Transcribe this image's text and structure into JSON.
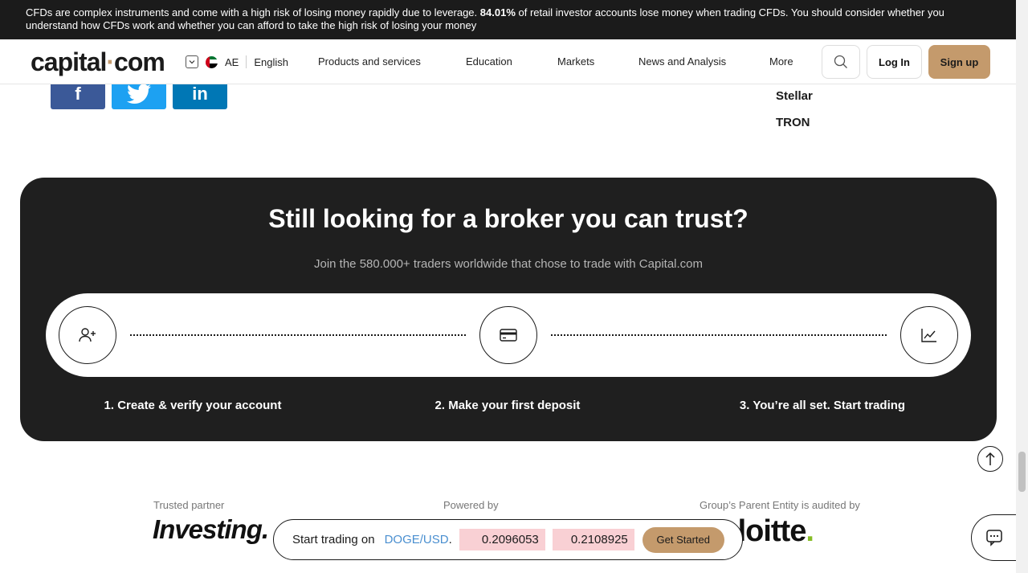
{
  "risk_banner": {
    "prefix": "CFDs are complex instruments and come with a high risk of losing money rapidly due to leverage.",
    "percent": "84.01%",
    "suffix": "of retail investor accounts lose money when trading CFDs. You should consider whether you understand how CFDs work and whether you can afford to take the high risk of losing your money"
  },
  "header": {
    "logo_left": "capital",
    "logo_dot": "·",
    "logo_right": "com",
    "region_code": "AE",
    "language": "English",
    "nav": [
      "Products and services",
      "Education",
      "Markets",
      "News and Analysis",
      "More"
    ],
    "login_label": "Log In",
    "signup_label": "Sign up"
  },
  "crypto_list": [
    "Stellar",
    "TRON"
  ],
  "trust_card": {
    "title": "Still looking for a broker you can trust?",
    "subtitle": "Join the 580.000+ traders worldwide that chose to trade with Capital.com",
    "steps": [
      "1. Create & verify your account",
      "2. Make your first deposit",
      "3. You’re all set. Start trading"
    ]
  },
  "partners": {
    "trusted_label": "Trusted partner",
    "trusted_name": "Investing.",
    "powered_label": "Powered by",
    "audited_label": "Group’s Parent Entity is audited by",
    "audited_name": "Deloitte",
    "audited_dot": "."
  },
  "trade_bar": {
    "prefix": "Start trading on",
    "symbol": "DOGE/USD",
    "period": ".",
    "sell_price": "0.2096053",
    "buy_price": "0.2108925",
    "cta": "Get Started"
  },
  "colors": {
    "brand_accent": "#c49a6c",
    "dark": "#1f1f1f",
    "symbol_blue": "#4a8fd0",
    "price_bg": "#f9d0d4",
    "facebook": "#3b5998",
    "twitter": "#1da1f2",
    "linkedin": "#0077b5"
  }
}
